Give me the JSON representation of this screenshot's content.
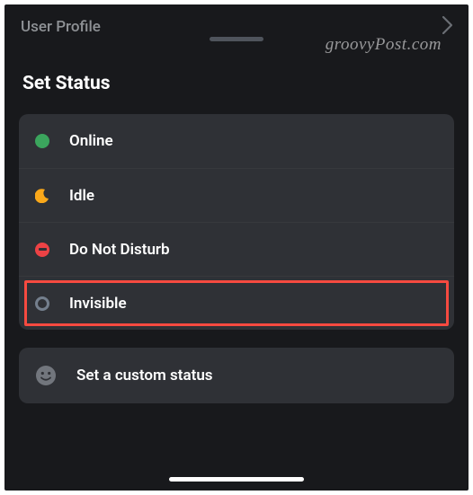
{
  "top_row": {
    "user_profile_label": "User Profile"
  },
  "watermark": "groovyPost.com",
  "heading": "Set Status",
  "status_options": [
    {
      "label": "Online",
      "icon": "online-icon",
      "highlighted": false
    },
    {
      "label": "Idle",
      "icon": "idle-icon",
      "highlighted": false
    },
    {
      "label": "Do Not Disturb",
      "icon": "dnd-icon",
      "highlighted": false
    },
    {
      "label": "Invisible",
      "icon": "invisible-icon",
      "highlighted": true
    }
  ],
  "custom_status": {
    "label": "Set a custom status"
  },
  "colors": {
    "background": "#18191c",
    "card": "#2f3136",
    "online": "#3ba55d",
    "idle": "#faa81a",
    "dnd": "#ed4245",
    "invisible": "#747f8d",
    "highlight": "#f64a40"
  }
}
